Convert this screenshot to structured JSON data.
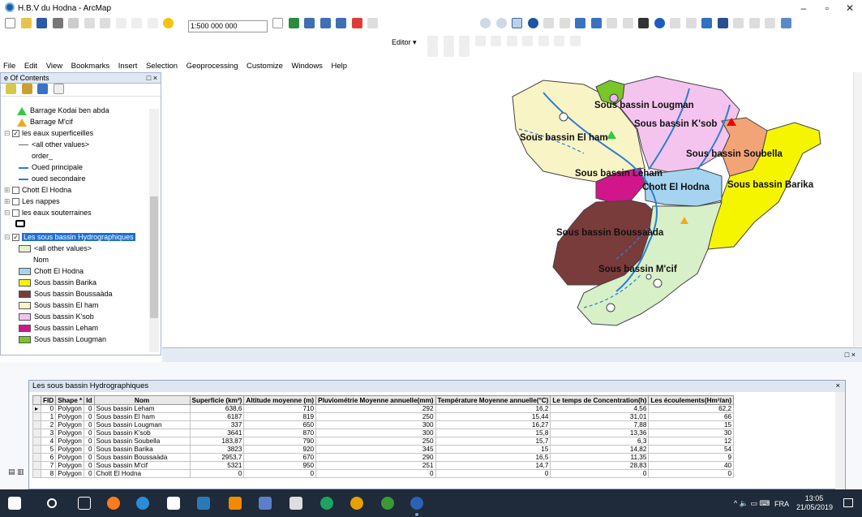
{
  "window": {
    "title": "H.B.V du Hodna - ArcMap",
    "min": "–",
    "max": "▫",
    "close": "✕"
  },
  "toolbar": {
    "scale": "1:500 000 000",
    "editor": "Editor ▾"
  },
  "menu": [
    "File",
    "Edit",
    "View",
    "Bookmarks",
    "Insert",
    "Selection",
    "Geoprocessing",
    "Customize",
    "Windows",
    "Help"
  ],
  "toc": {
    "title": "e Of Contents",
    "close": "□ ×",
    "items": [
      {
        "label": "Barrage Kodai ben abda",
        "sym": "tri-green"
      },
      {
        "label": "Barrage M'cif",
        "sym": "tri-orange"
      },
      {
        "label": "les eaux superficeilles",
        "check": "✓"
      },
      {
        "label": "<all other values>",
        "sym": "line-gray"
      },
      {
        "label": "order_"
      },
      {
        "label": "Oued principale",
        "sym": "line-blue"
      },
      {
        "label": "oued secondaire",
        "sym": "line-blue"
      },
      {
        "label": "Chott El Hodna",
        "check": ""
      },
      {
        "label": "Les nappes",
        "check": ""
      },
      {
        "label": "les eaux souterraines",
        "check": ""
      },
      {
        "label": "Les sous bassin Hydrographiques",
        "check": "✓"
      },
      {
        "label": "<all other values>",
        "color": "#e8f2c8"
      },
      {
        "label": "Nom"
      },
      {
        "label": "Chott  El Hodna",
        "color": "#a6d4f0"
      },
      {
        "label": "Sous bassin Barika",
        "color": "#f5f500"
      },
      {
        "label": "Sous bassin Boussaàda",
        "color": "#7a3b3b"
      },
      {
        "label": "Sous bassin El ham",
        "color": "#f9f4c6"
      },
      {
        "label": "Sous bassin K'sob",
        "color": "#f4c4ee"
      },
      {
        "label": "Sous bassin Leham",
        "color": "#d1168c"
      },
      {
        "label": "Sous bassin Lougman",
        "color": "#7ac52a"
      }
    ]
  },
  "map": {
    "labels": [
      "Sous bassin Lougman",
      "Sous bassin K'sob",
      "Sous bassin El ham",
      "Sous bassin Soubella",
      "Sous bassin Leham",
      "Chott  El Hodna",
      "Sous bassin Barika",
      "Sous bassin Boussaàda",
      "Sous bassin M'cif"
    ]
  },
  "attr_panel_close": "□ ×",
  "attr_table": {
    "title": "Les sous bassin Hydrographiques",
    "close": "×",
    "columns": [
      "FID",
      "Shape *",
      "Id",
      "Nom",
      "Superficie (km²)",
      "Altitude moyenne (m)",
      "Pluviométrie Moyenne annuelle(mm)",
      "Température Moyenne annuelle(°C)",
      "Le temps de Concentration(h)",
      "Les  écoulements(Hm³/an)"
    ],
    "rows": [
      [
        "0",
        "Polygon",
        "0",
        "Sous bassin Leham",
        "638,6",
        "710",
        "292",
        "16,2",
        "4,56",
        "62,2"
      ],
      [
        "1",
        "Polygon",
        "0",
        "Sous bassin El ham",
        "6187",
        "819",
        "250",
        "15,44",
        "31,01",
        "66"
      ],
      [
        "2",
        "Polygon",
        "0",
        "Sous bassin Lougman",
        "337",
        "650",
        "300",
        "16,27",
        "7,88",
        "15"
      ],
      [
        "3",
        "Polygon",
        "0",
        "Sous bassin K'sob",
        "3641",
        "870",
        "300",
        "15,8",
        "13,36",
        "30"
      ],
      [
        "4",
        "Polygon",
        "0",
        "Sous bassin Soubella",
        "183,87",
        "790",
        "250",
        "15,7",
        "6,3",
        "12"
      ],
      [
        "5",
        "Polygon",
        "0",
        "Sous bassin Barika",
        "3823",
        "920",
        "345",
        "15",
        "14,82",
        "54"
      ],
      [
        "6",
        "Polygon",
        "0",
        "Sous bassin Boussaàda",
        "2953,7",
        "670",
        "290",
        "16,5",
        "11,35",
        "9"
      ],
      [
        "7",
        "Polygon",
        "0",
        "Sous bassin M'cif",
        "5321",
        "950",
        "251",
        "14,7",
        "28,83",
        "40"
      ],
      [
        "8",
        "Polygon",
        "0",
        "Chott  El Hodna",
        "0",
        "0",
        "0",
        "0",
        "0",
        "0"
      ]
    ]
  },
  "taskbar": {
    "lang": "FRA",
    "time": "13:05",
    "date": "21/05/2019"
  }
}
